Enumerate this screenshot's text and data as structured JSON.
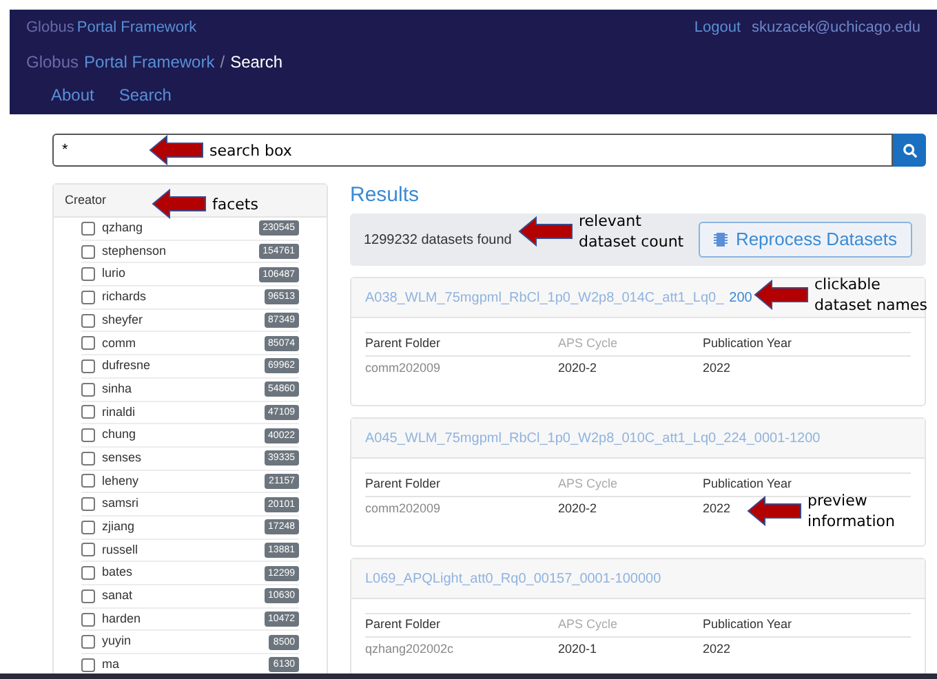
{
  "header": {
    "brand_prefix": "Globus",
    "brand": "Portal Framework",
    "logout": "Logout",
    "user": "skuzacek@uchicago.edu"
  },
  "breadcrumb": {
    "prefix": "Globus",
    "items": [
      {
        "label": "Portal Framework"
      },
      {
        "label": "Search"
      }
    ],
    "separator": "/"
  },
  "nav": [
    {
      "label": "About"
    },
    {
      "label": "Search"
    }
  ],
  "search": {
    "value": "*"
  },
  "facets": {
    "title": "Creator",
    "items": [
      {
        "label": "qzhang",
        "count": "230545",
        "checked": false
      },
      {
        "label": "stephenson",
        "count": "154761",
        "checked": false
      },
      {
        "label": "lurio",
        "count": "106487",
        "checked": false
      },
      {
        "label": "richards",
        "count": "96513",
        "checked": false
      },
      {
        "label": "sheyfer",
        "count": "87349",
        "checked": false
      },
      {
        "label": "comm",
        "count": "85074",
        "checked": false
      },
      {
        "label": "dufresne",
        "count": "69962",
        "checked": false
      },
      {
        "label": "sinha",
        "count": "54860",
        "checked": false
      },
      {
        "label": "rinaldi",
        "count": "47109",
        "checked": false
      },
      {
        "label": "chung",
        "count": "40022",
        "checked": false
      },
      {
        "label": "senses",
        "count": "39335",
        "checked": false
      },
      {
        "label": "leheny",
        "count": "21157",
        "checked": false
      },
      {
        "label": "samsri",
        "count": "20101",
        "checked": false
      },
      {
        "label": "zjiang",
        "count": "17248",
        "checked": false
      },
      {
        "label": "russell",
        "count": "13881",
        "checked": false
      },
      {
        "label": "bates",
        "count": "12299",
        "checked": false
      },
      {
        "label": "sanat",
        "count": "10630",
        "checked": false
      },
      {
        "label": "harden",
        "count": "10472",
        "checked": false
      },
      {
        "label": "yuyin",
        "count": "8500",
        "checked": false
      },
      {
        "label": "ma",
        "count": "6130",
        "checked": false
      }
    ]
  },
  "results": {
    "title": "Results",
    "count": "1299232 datasets found",
    "action": "Reprocess Datasets",
    "items": [
      {
        "title": "A038_WLM_75mgpml_RbCl_1p0_W2p8_014C_att1_Lq0_",
        "title_end": "200",
        "columns": [
          "Parent Folder",
          "APS Cycle",
          "Publication Year"
        ],
        "values": [
          "comm202009",
          "2020-2",
          "2022"
        ]
      },
      {
        "title": "A045_WLM_75mgpml_RbCl_1p0_W2p8_010C_att1_Lq0_224_0001-1200",
        "columns": [
          "Parent Folder",
          "APS Cycle",
          "Publication Year"
        ],
        "values": [
          "comm202009",
          "2020-2",
          "2022"
        ]
      },
      {
        "title": "L069_APQLight_att0_Rq0_00157_0001-100000",
        "columns": [
          "Parent Folder",
          "APS Cycle",
          "Publication Year"
        ],
        "values": [
          "qzhang202002c",
          "2020-1",
          "2022"
        ]
      }
    ]
  },
  "annotations": [
    {
      "lines": [
        "search box"
      ]
    },
    {
      "lines": [
        "facets"
      ]
    },
    {
      "lines": [
        "relevant",
        "dataset count"
      ]
    },
    {
      "lines": [
        "clickable",
        "dataset names"
      ]
    },
    {
      "lines": [
        "preview",
        "information"
      ]
    }
  ]
}
